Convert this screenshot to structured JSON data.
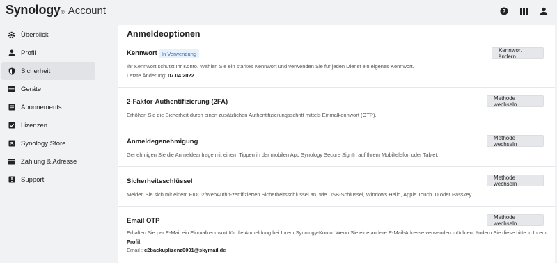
{
  "header": {
    "logo_text": "Synology",
    "app_name": "Account"
  },
  "sidebar": {
    "items": [
      {
        "label": "Überblick",
        "icon": "settings-gear-icon"
      },
      {
        "label": "Profil",
        "icon": "person-icon"
      },
      {
        "label": "Sicherheit",
        "icon": "shield-icon",
        "active": true
      },
      {
        "label": "Geräte",
        "icon": "device-icon"
      },
      {
        "label": "Abonnements",
        "icon": "subscriptions-icon"
      },
      {
        "label": "Lizenzen",
        "icon": "license-icon"
      },
      {
        "label": "Synology Store",
        "icon": "store-icon"
      },
      {
        "label": "Zahlung & Adresse",
        "icon": "payment-card-icon"
      },
      {
        "label": "Support",
        "icon": "support-icon"
      }
    ]
  },
  "main": {
    "title": "Anmeldeoptionen",
    "password": {
      "title": "Kennwort",
      "badge": "In Verwendung",
      "button": "Kennwort ändern",
      "desc": "Ihr Kennwort schützt Ihr Konto. Wählen Sie ein starkes Kennwort und verwenden Sie für jeden Dienst ein eigenes Kennwort.",
      "last_change_label": "Letzte Änderung:",
      "last_change_value": "07.04.2022"
    },
    "twofa": {
      "title": "2-Faktor-Authentifizierung (2FA)",
      "button": "Methode wechseln",
      "desc": "Erhöhen Sie die Sicherheit durch einen zusätzlichen Authentifizierungsschritt mittels Einmalkennwort (OTP)."
    },
    "approval": {
      "title": "Anmeldegenehmigung",
      "button": "Methode wechseln",
      "desc": "Genehmigen Sie die Anmeldeanfrage mit einem Tippen in der mobilen App Synology Secure SignIn auf Ihrem Mobiltelefon oder Tablet."
    },
    "key": {
      "title": "Sicherheitsschlüssel",
      "button": "Methode wechseln",
      "desc": "Melden Sie sich mit einem FIDO2/WebAuthn-zertifizierten Sicherheitsschlüssel an, wie USB-Schlüssel, Windows Hello, Apple Touch ID oder Passkey."
    },
    "email_otp": {
      "title": "Email OTP",
      "button": "Methode wechseln",
      "desc_line1": "Erhalten Sie per E-Mail ein Einmalkennwort für die Anmeldung bei Ihrem Synology-Konto. Wenn Sie eine andere E-Mail-Adresse verwenden möchten, ändern Sie diese bitte in Ihrem",
      "desc_link": "Profil",
      "desc_period": ".",
      "email_label": "Email :",
      "email_value": "c2backuplizenz0001@skymail.de"
    }
  }
}
